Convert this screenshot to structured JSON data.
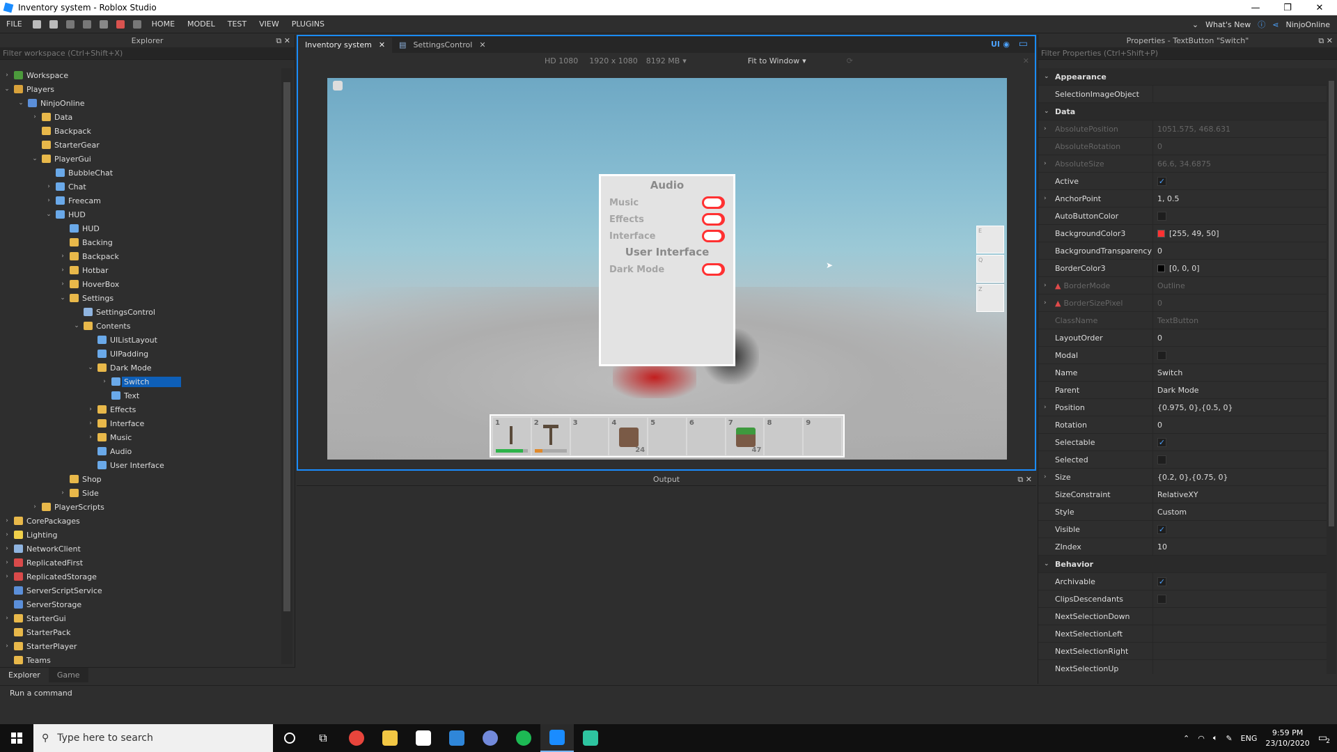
{
  "window": {
    "title": "Inventory system - Roblox Studio",
    "controls": [
      "—",
      "❐",
      "✕"
    ]
  },
  "menubar": {
    "file": "FILE",
    "items": [
      "HOME",
      "MODEL",
      "TEST",
      "VIEW",
      "PLUGINS"
    ],
    "whats_new": "What's New",
    "user": "NinjoOnline"
  },
  "explorer": {
    "title": "Explorer",
    "filter_placeholder": "Filter workspace (Ctrl+Shift+X)",
    "tree": [
      {
        "label": "Workspace",
        "depth": 0,
        "arrow": "›",
        "icon": "#4c9a3c"
      },
      {
        "label": "Players",
        "depth": 0,
        "arrow": "⌄",
        "icon": "#d9a23b"
      },
      {
        "label": "NinjoOnline",
        "depth": 1,
        "arrow": "⌄",
        "icon": "#5b8fd9"
      },
      {
        "label": "Data",
        "depth": 2,
        "arrow": "›",
        "icon": "#e8b84a"
      },
      {
        "label": "Backpack",
        "depth": 2,
        "arrow": "",
        "icon": "#e8b84a"
      },
      {
        "label": "StarterGear",
        "depth": 2,
        "arrow": "",
        "icon": "#e8b84a"
      },
      {
        "label": "PlayerGui",
        "depth": 2,
        "arrow": "⌄",
        "icon": "#e8b84a"
      },
      {
        "label": "BubbleChat",
        "depth": 3,
        "arrow": "",
        "icon": "#6aa9e9"
      },
      {
        "label": "Chat",
        "depth": 3,
        "arrow": "›",
        "icon": "#6aa9e9"
      },
      {
        "label": "Freecam",
        "depth": 3,
        "arrow": "›",
        "icon": "#6aa9e9"
      },
      {
        "label": "HUD",
        "depth": 3,
        "arrow": "⌄",
        "icon": "#6aa9e9"
      },
      {
        "label": "HUD",
        "depth": 4,
        "arrow": "",
        "icon": "#6aa9e9"
      },
      {
        "label": "Backing",
        "depth": 4,
        "arrow": "",
        "icon": "#e8b84a"
      },
      {
        "label": "Backpack",
        "depth": 4,
        "arrow": "›",
        "icon": "#e8b84a"
      },
      {
        "label": "Hotbar",
        "depth": 4,
        "arrow": "›",
        "icon": "#e8b84a"
      },
      {
        "label": "HoverBox",
        "depth": 4,
        "arrow": "›",
        "icon": "#e8b84a"
      },
      {
        "label": "Settings",
        "depth": 4,
        "arrow": "⌄",
        "icon": "#e8b84a"
      },
      {
        "label": "SettingsControl",
        "depth": 5,
        "arrow": "",
        "icon": "#8fb4e0"
      },
      {
        "label": "Contents",
        "depth": 5,
        "arrow": "⌄",
        "icon": "#e8b84a"
      },
      {
        "label": "UIListLayout",
        "depth": 6,
        "arrow": "",
        "icon": "#6aa9e9"
      },
      {
        "label": "UIPadding",
        "depth": 6,
        "arrow": "",
        "icon": "#6aa9e9"
      },
      {
        "label": "Dark Mode",
        "depth": 6,
        "arrow": "⌄",
        "icon": "#e8b84a"
      },
      {
        "label": "Switch",
        "depth": 7,
        "arrow": "›",
        "icon": "#6aa9e9",
        "selected": true
      },
      {
        "label": "Text",
        "depth": 7,
        "arrow": "",
        "icon": "#6aa9e9"
      },
      {
        "label": "Effects",
        "depth": 6,
        "arrow": "›",
        "icon": "#e8b84a"
      },
      {
        "label": "Interface",
        "depth": 6,
        "arrow": "›",
        "icon": "#e8b84a"
      },
      {
        "label": "Music",
        "depth": 6,
        "arrow": "›",
        "icon": "#e8b84a"
      },
      {
        "label": "Audio",
        "depth": 6,
        "arrow": "",
        "icon": "#6aa9e9"
      },
      {
        "label": "User Interface",
        "depth": 6,
        "arrow": "",
        "icon": "#6aa9e9"
      },
      {
        "label": "Shop",
        "depth": 4,
        "arrow": "",
        "icon": "#e8b84a"
      },
      {
        "label": "Side",
        "depth": 4,
        "arrow": "›",
        "icon": "#e8b84a"
      },
      {
        "label": "PlayerScripts",
        "depth": 2,
        "arrow": "›",
        "icon": "#e8b84a"
      },
      {
        "label": "CorePackages",
        "depth": 0,
        "arrow": "›",
        "icon": "#e8b84a"
      },
      {
        "label": "Lighting",
        "depth": 0,
        "arrow": "›",
        "icon": "#f0d04a"
      },
      {
        "label": "NetworkClient",
        "depth": 0,
        "arrow": "›",
        "icon": "#8fb4e0"
      },
      {
        "label": "ReplicatedFirst",
        "depth": 0,
        "arrow": "›",
        "icon": "#d94a4a"
      },
      {
        "label": "ReplicatedStorage",
        "depth": 0,
        "arrow": "›",
        "icon": "#d94a4a"
      },
      {
        "label": "ServerScriptService",
        "depth": 0,
        "arrow": "",
        "icon": "#5b8fd9"
      },
      {
        "label": "ServerStorage",
        "depth": 0,
        "arrow": "",
        "icon": "#5b8fd9"
      },
      {
        "label": "StarterGui",
        "depth": 0,
        "arrow": "›",
        "icon": "#e8b84a"
      },
      {
        "label": "StarterPack",
        "depth": 0,
        "arrow": "",
        "icon": "#e8b84a"
      },
      {
        "label": "StarterPlayer",
        "depth": 0,
        "arrow": "›",
        "icon": "#e8b84a"
      },
      {
        "label": "Teams",
        "depth": 0,
        "arrow": "",
        "icon": "#e8b84a"
      }
    ],
    "tabs": [
      "Explorer",
      "Game"
    ]
  },
  "viewport": {
    "tabs": [
      {
        "label": "Inventory system",
        "active": true
      },
      {
        "label": "SettingsControl",
        "active": false
      }
    ],
    "ui_toggle": "UI",
    "device": "HD 1080",
    "resolution": "1920 x 1080",
    "memory": "8192 MB",
    "fit": "Fit to Window",
    "settings_panel": {
      "audio_heading": "Audio",
      "music": "Music",
      "effects": "Effects",
      "interface": "Interface",
      "ui_heading": "User Interface",
      "dark_mode": "Dark Mode"
    },
    "side_keys": [
      "E",
      "Q",
      "Z"
    ],
    "hotbar": [
      {
        "n": "1",
        "count": "",
        "item": "hammer",
        "bar": "#2db34a",
        "fill": 0.85
      },
      {
        "n": "2",
        "count": "",
        "item": "pickaxe",
        "bar": "#e0892b",
        "fill": 0.25
      },
      {
        "n": "3",
        "count": "",
        "item": "",
        "bar": "",
        "fill": 0
      },
      {
        "n": "4",
        "count": "24",
        "item": "crate",
        "bar": "",
        "fill": 0
      },
      {
        "n": "5",
        "count": "",
        "item": "",
        "bar": "",
        "fill": 0
      },
      {
        "n": "6",
        "count": "",
        "item": "",
        "bar": "",
        "fill": 0
      },
      {
        "n": "7",
        "count": "47",
        "item": "grass",
        "bar": "",
        "fill": 0
      },
      {
        "n": "8",
        "count": "",
        "item": "",
        "bar": "",
        "fill": 0
      },
      {
        "n": "9",
        "count": "",
        "item": "",
        "bar": "",
        "fill": 0
      }
    ]
  },
  "output": {
    "title": "Output"
  },
  "properties": {
    "title": "Properties - TextButton \"Switch\"",
    "filter_placeholder": "Filter Properties (Ctrl+Shift+P)",
    "rows": [
      {
        "cat": "Appearance"
      },
      {
        "k": "SelectionImageObject",
        "v": ""
      },
      {
        "cat": "Data"
      },
      {
        "k": "AbsolutePosition",
        "v": "1051.575, 468.631",
        "dim": true,
        "arrow": true
      },
      {
        "k": "AbsoluteRotation",
        "v": "0",
        "dim": true
      },
      {
        "k": "AbsoluteSize",
        "v": "66.6, 34.6875",
        "dim": true,
        "arrow": true
      },
      {
        "k": "Active",
        "v": "",
        "check": true,
        "checked": true
      },
      {
        "k": "AnchorPoint",
        "v": "1, 0.5",
        "arrow": true
      },
      {
        "k": "AutoButtonColor",
        "v": "",
        "check": true,
        "checked": false
      },
      {
        "k": "BackgroundColor3",
        "v": "[255, 49, 50]",
        "swatch": "#ff3132"
      },
      {
        "k": "BackgroundTransparency",
        "v": "0"
      },
      {
        "k": "BorderColor3",
        "v": "[0, 0, 0]",
        "swatch": "#000000"
      },
      {
        "k": "BorderMode",
        "v": "Outline",
        "dim": true,
        "arrow": true,
        "warn": true
      },
      {
        "k": "BorderSizePixel",
        "v": "0",
        "dim": true,
        "arrow": true,
        "warn": true
      },
      {
        "k": "ClassName",
        "v": "TextButton",
        "dim": true
      },
      {
        "k": "LayoutOrder",
        "v": "0"
      },
      {
        "k": "Modal",
        "v": "",
        "check": true,
        "checked": false
      },
      {
        "k": "Name",
        "v": "Switch"
      },
      {
        "k": "Parent",
        "v": "Dark Mode"
      },
      {
        "k": "Position",
        "v": "{0.975, 0},{0.5, 0}",
        "arrow": true
      },
      {
        "k": "Rotation",
        "v": "0"
      },
      {
        "k": "Selectable",
        "v": "",
        "check": true,
        "checked": true
      },
      {
        "k": "Selected",
        "v": "",
        "check": true,
        "checked": false
      },
      {
        "k": "Size",
        "v": "{0.2, 0},{0.75, 0}",
        "arrow": true
      },
      {
        "k": "SizeConstraint",
        "v": "RelativeXY"
      },
      {
        "k": "Style",
        "v": "Custom"
      },
      {
        "k": "Visible",
        "v": "",
        "check": true,
        "checked": true
      },
      {
        "k": "ZIndex",
        "v": "10"
      },
      {
        "cat": "Behavior"
      },
      {
        "k": "Archivable",
        "v": "",
        "check": true,
        "checked": true
      },
      {
        "k": "ClipsDescendants",
        "v": "",
        "check": true,
        "checked": false
      },
      {
        "k": "NextSelectionDown",
        "v": ""
      },
      {
        "k": "NextSelectionLeft",
        "v": ""
      },
      {
        "k": "NextSelectionRight",
        "v": ""
      },
      {
        "k": "NextSelectionUp",
        "v": ""
      }
    ]
  },
  "command_bar": {
    "placeholder": "Run a command"
  },
  "taskbar": {
    "search_placeholder": "Type here to search",
    "apps": [
      {
        "name": "chrome-icon",
        "color": "#e8453c"
      },
      {
        "name": "file-explorer-icon",
        "color": "#f2c744"
      },
      {
        "name": "store-icon",
        "color": "#ffffff"
      },
      {
        "name": "mail-icon",
        "color": "#2f86d9"
      },
      {
        "name": "discord-icon",
        "color": "#7289da"
      },
      {
        "name": "spotify-icon",
        "color": "#1db954"
      },
      {
        "name": "roblox-studio-icon",
        "color": "#1a8cff",
        "active": true
      },
      {
        "name": "app-icon",
        "color": "#2ec4a0"
      }
    ],
    "lang": "ENG",
    "time": "9:59 PM",
    "date": "23/10/2020",
    "notifications": "2"
  },
  "colors": {
    "accent": "#1a8cff",
    "toggle_red": "#ff3132",
    "selection": "#0e5fb8"
  }
}
